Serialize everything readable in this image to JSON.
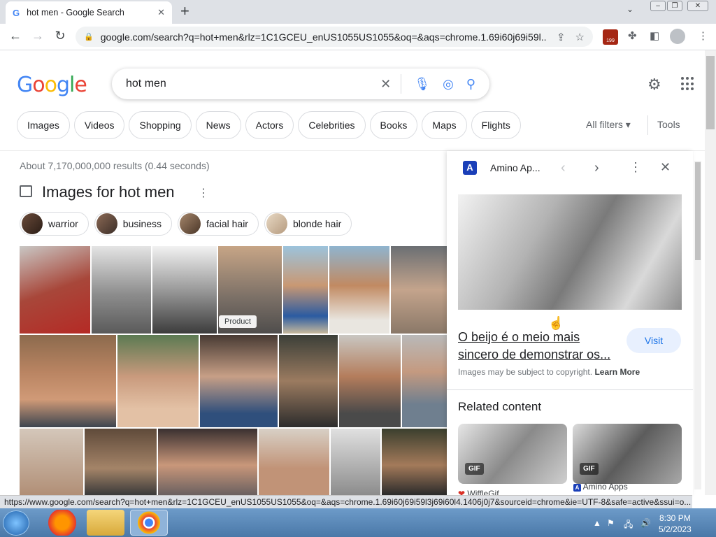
{
  "browser": {
    "tab_title": "hot men - Google Search",
    "tab_favicon": "G",
    "tab_close": "✕",
    "new_tab": "+",
    "url": "google.com/search?q=hot+men&rlz=1C1GCEU_enUS1055US1055&oq=&aqs=chrome.1.69i60j69i59l...",
    "calendar_badge": "199",
    "status_url": "https://www.google.com/search?q=hot+men&rlz=1C1GCEU_enUS1055US1055&oq=&aqs=chrome.1.69i60j69i59l3j69i60l4.1406j0j7&sourceid=chrome&ie=UTF-8&safe=active&ssui=o..."
  },
  "header": {
    "logo": [
      "G",
      "o",
      "o",
      "g",
      "l",
      "e"
    ],
    "logo_colors": [
      "#4285f4",
      "#ea4335",
      "#fbbc05",
      "#4285f4",
      "#34a853",
      "#ea4335"
    ],
    "query": "hot men",
    "chips": [
      "Images",
      "Videos",
      "Shopping",
      "News",
      "Actors",
      "Celebrities",
      "Books",
      "Maps",
      "Flights"
    ],
    "all_filters": "All filters ▾",
    "tools": "Tools"
  },
  "results": {
    "stats": "About 7,170,000,000 results (0.44 seconds)",
    "images_heading": "Images for hot men",
    "refine_chips": [
      "warrior",
      "business",
      "facial hair",
      "blonde hair"
    ],
    "product_badge": "Product"
  },
  "panel": {
    "source": "Amino Ap...",
    "source_favicon": "A",
    "title": "O beijo é o meio mais sincero de demonstrar os...",
    "visit": "Visit",
    "copyright": "Images may be subject to copyright.",
    "learn_more": "Learn More",
    "related_heading": "Related content",
    "gif_label": "GIF",
    "related_source_1": "WiffleGif",
    "related_source_2": "Amino Apps"
  },
  "taskbar": {
    "time": "8:30 PM",
    "date": "5/2/2023"
  },
  "colors": {
    "google_blue": "#1a73e8",
    "chrome_frame": "#dee1e6",
    "taskbar": "#4a78a8"
  }
}
